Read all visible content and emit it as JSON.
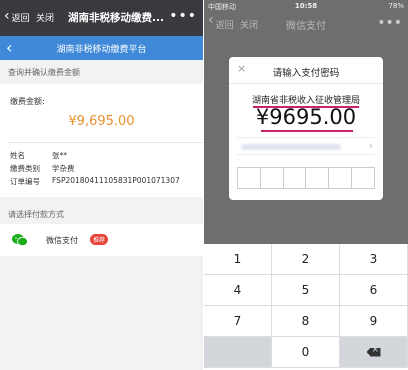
{
  "left": {
    "nav": {
      "back_label": "返回",
      "close_label": "关闭",
      "title": "湖南非税移动缴费...",
      "more": "•••"
    },
    "bar_title": "湖南非税移动缴费平台",
    "confirm_section": "查询并确认缴费金额",
    "amount_label": "缴费金额:",
    "amount_value": "¥9,695.00",
    "details": [
      {
        "key": "姓名",
        "value": "张**"
      },
      {
        "key": "缴费类别",
        "value": "学杂费"
      },
      {
        "key": "订单编号",
        "value": "FSP20180411105831P001071307"
      }
    ],
    "method_section": "请选择付款方式",
    "method": {
      "name": "微信支付",
      "badge": "推荐"
    }
  },
  "right": {
    "status": {
      "carrier": "中国移动",
      "time": "10:58",
      "battery": "78%"
    },
    "nav": {
      "back_label": "返回",
      "close_label": "关闭",
      "title": "微信支付",
      "more": "•••"
    },
    "dialog": {
      "close": "×",
      "title": "请输入支付密码",
      "merchant": "湖南省非税收入征收管理局",
      "amount": "¥9695.00"
    },
    "keypad": {
      "keys": [
        "1",
        "2",
        "3",
        "4",
        "5",
        "6",
        "7",
        "8",
        "9",
        "",
        "0",
        ""
      ]
    }
  },
  "colors": {
    "nav_dark": "#393a3f",
    "accent_blue": "#3f89d8",
    "amount_orange": "#e8902c",
    "wechat_green": "#1aad19",
    "highlight": "#c9226a"
  }
}
